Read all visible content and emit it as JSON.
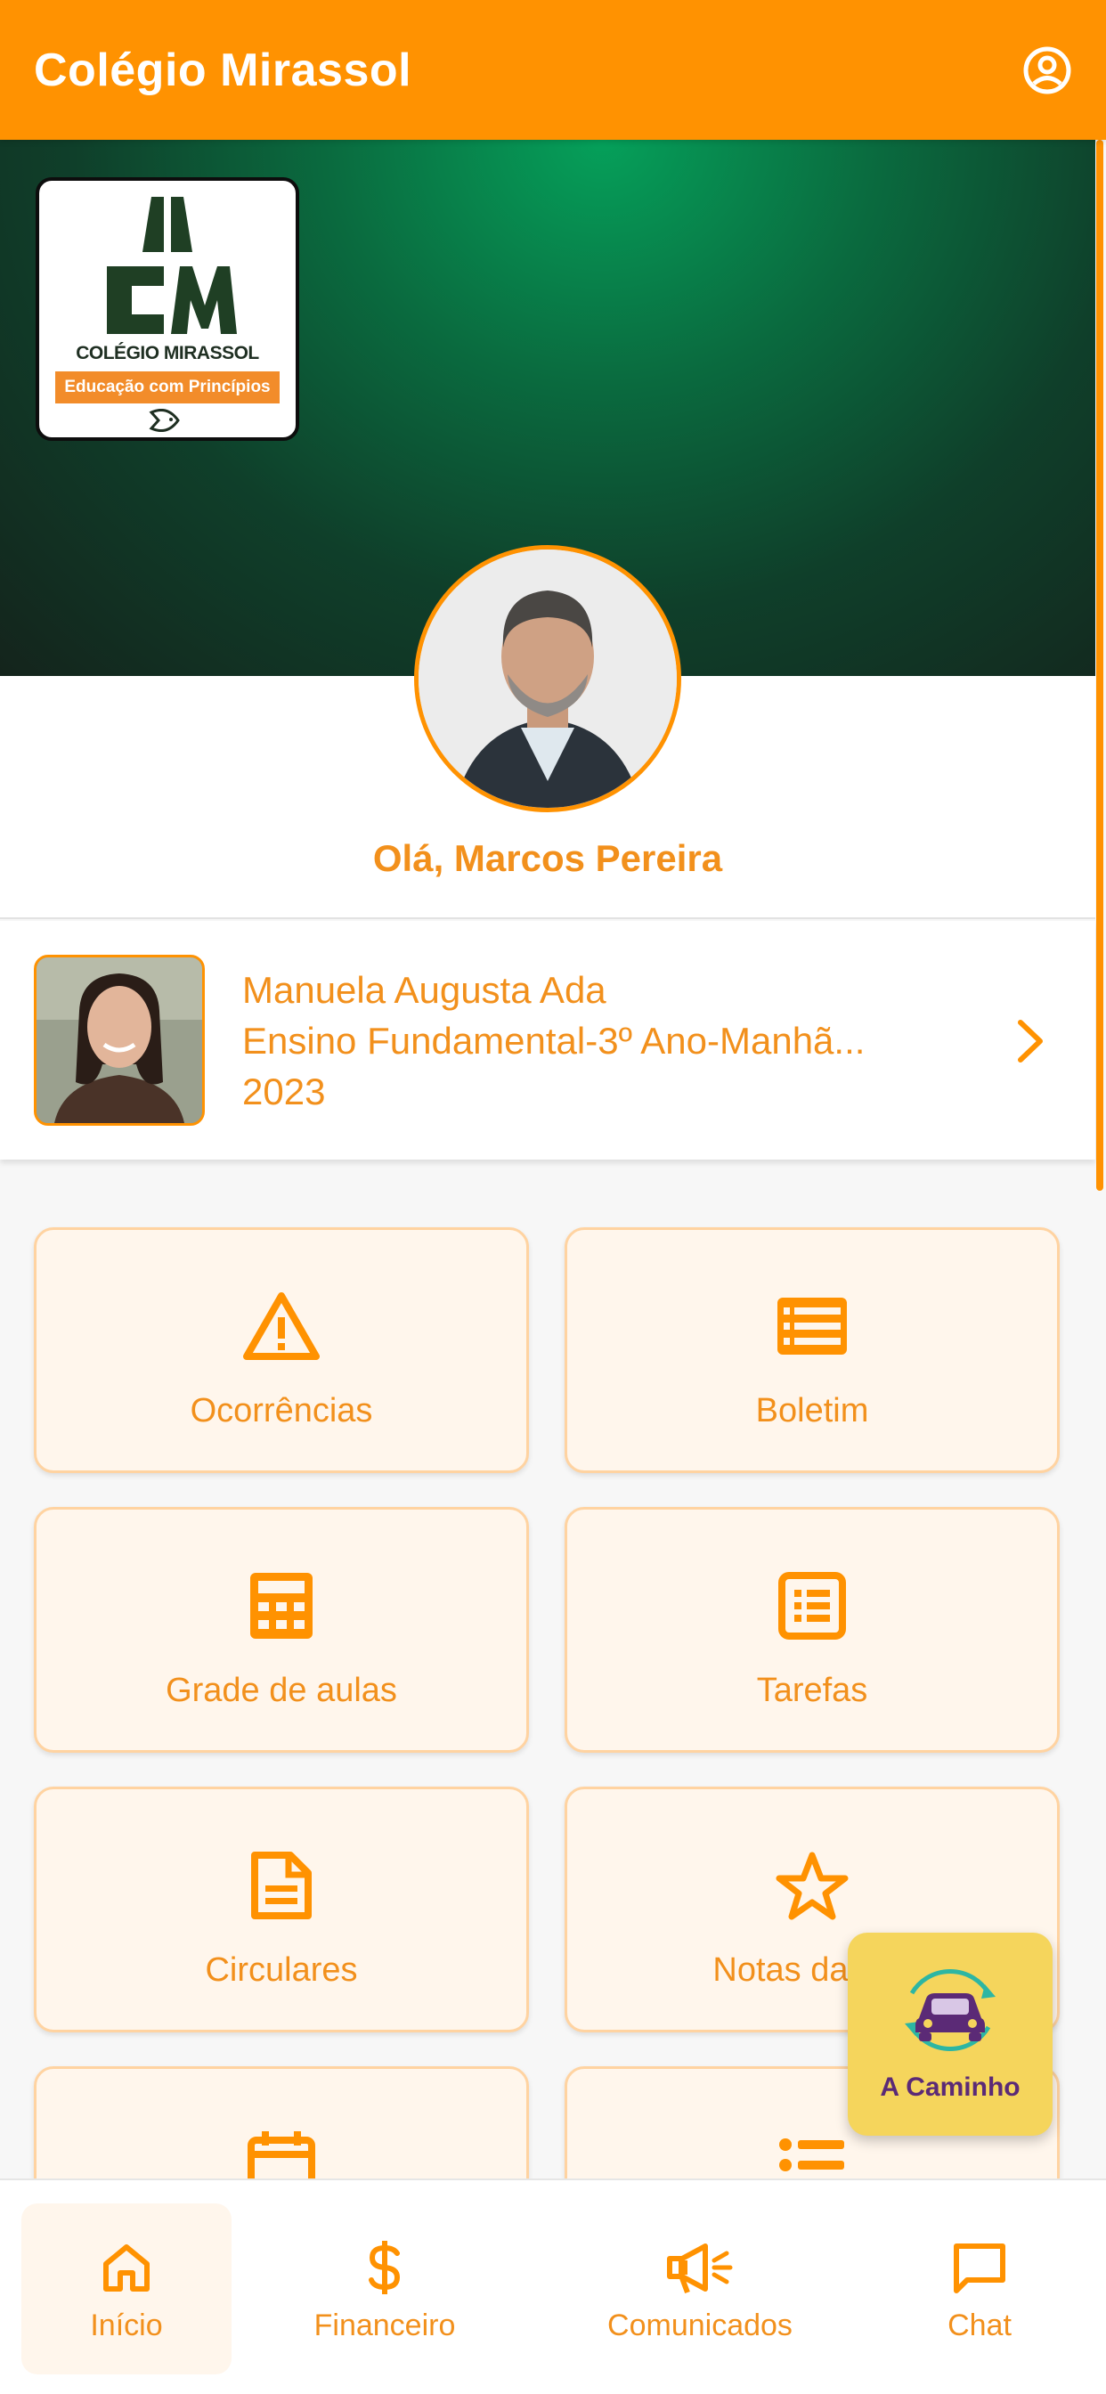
{
  "app": {
    "title": "Colégio Mirassol",
    "accent_color": "#FF9201",
    "account_icon": "account-circle-icon"
  },
  "school_logo": {
    "monogram": "CM",
    "name": "COLÉGIO MIRASSOL",
    "tagline": "Educação com Princípios"
  },
  "profile": {
    "greeting": "Olá, Marcos Pereira"
  },
  "student": {
    "name": "Manuela Augusta Ada",
    "class": "Ensino Fundamental-3º Ano-Manhã...",
    "year": "2023"
  },
  "menu": [
    {
      "label": "Ocorrências",
      "icon": "warning-icon"
    },
    {
      "label": "Boletim",
      "icon": "report-table-icon"
    },
    {
      "label": "Grade de aulas",
      "icon": "calendar-grid-icon"
    },
    {
      "label": "Tarefas",
      "icon": "task-list-icon"
    },
    {
      "label": "Circulares",
      "icon": "document-icon"
    },
    {
      "label": "Notas das Av",
      "icon": "star-icon"
    },
    {
      "label": "",
      "icon": "calendar-icon"
    },
    {
      "label": "",
      "icon": "list-icon"
    }
  ],
  "fab": {
    "label": "A Caminho",
    "icon": "car-icon",
    "color": "#F5D55C"
  },
  "bottom_nav": [
    {
      "label": "Início",
      "icon": "home-icon",
      "active": true
    },
    {
      "label": "Financeiro",
      "icon": "dollar-icon",
      "active": false
    },
    {
      "label": "Comunicados",
      "icon": "megaphone-icon",
      "active": false
    },
    {
      "label": "Chat",
      "icon": "chat-icon",
      "active": false
    }
  ]
}
